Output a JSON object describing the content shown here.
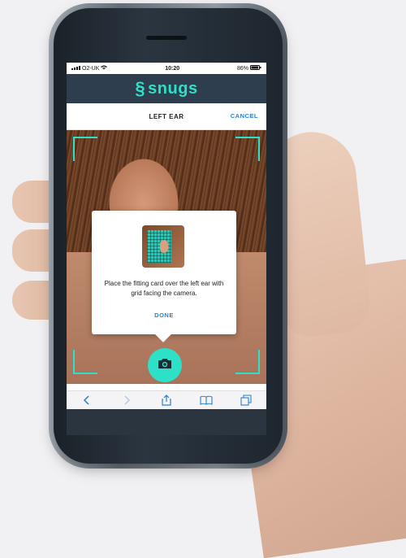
{
  "status_bar": {
    "carrier": "O2-UK",
    "time": "10:20",
    "battery": "86%"
  },
  "brand": {
    "name": "snugs",
    "mark": "§",
    "color": "#2fe0c8"
  },
  "nav": {
    "title": "LEFT EAR",
    "cancel_label": "CANCEL"
  },
  "dialog": {
    "message": "Place the fitting card over the left ear with grid facing the camera.",
    "done_label": "DONE"
  },
  "toolbar": {
    "items": [
      "back-icon",
      "forward-icon",
      "share-icon",
      "bookmarks-icon",
      "tabs-icon"
    ]
  },
  "colors": {
    "accent": "#2fe0c8",
    "link": "#2a7fd1",
    "header_bg": "#2f3e4e"
  }
}
